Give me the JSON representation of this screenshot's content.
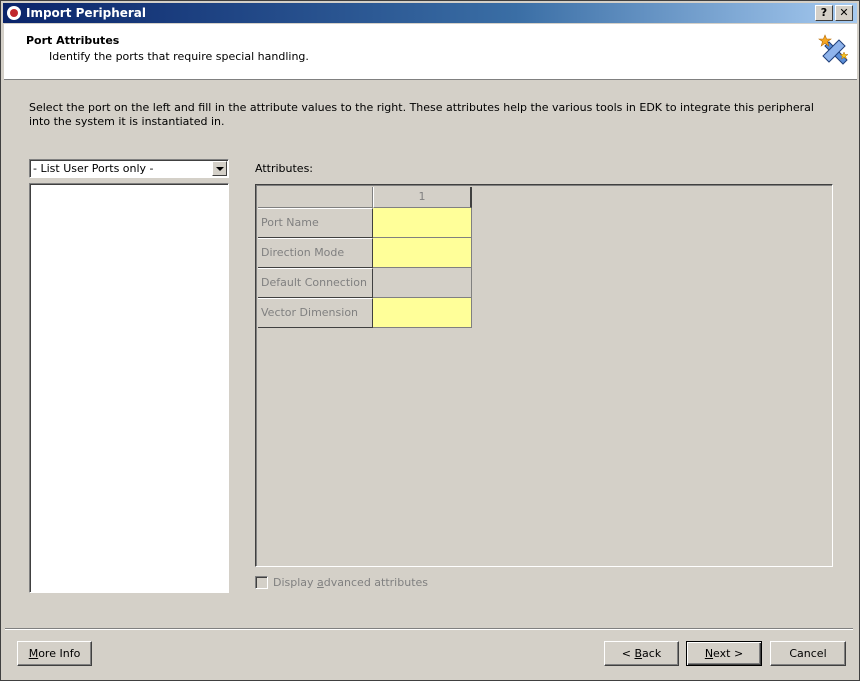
{
  "window": {
    "title": "Import Peripheral"
  },
  "titlebar_buttons": {
    "help": "?",
    "close": "✕"
  },
  "header": {
    "title": "Port Attributes",
    "subtitle": "Identify the ports that require special handling."
  },
  "instructions": "Select the port on the left and fill in the attribute values to the right. These attributes help the various tools in EDK to integrate this peripheral into the system it is instantiated in.",
  "port_filter": {
    "selected": "- List User Ports only -"
  },
  "attributes": {
    "label": "Attributes:",
    "column_header": "1",
    "rows": [
      {
        "label": "Port Name",
        "editable": true
      },
      {
        "label": "Direction Mode",
        "editable": true
      },
      {
        "label": "Default Connection",
        "editable": false
      },
      {
        "label": "Vector Dimension",
        "editable": true
      }
    ]
  },
  "advanced": {
    "label_pre": "Display ",
    "label_accel": "a",
    "label_post": "dvanced attributes",
    "checked": false
  },
  "buttons": {
    "more_info_accel": "M",
    "more_info_rest": "ore Info",
    "back_pre": "< ",
    "back_accel": "B",
    "back_rest": "ack",
    "next_accel": "N",
    "next_rest": "ext >",
    "cancel": "Cancel"
  },
  "colors": {
    "editable_cell": "#ffff99",
    "title_bar": "#0a246a"
  }
}
